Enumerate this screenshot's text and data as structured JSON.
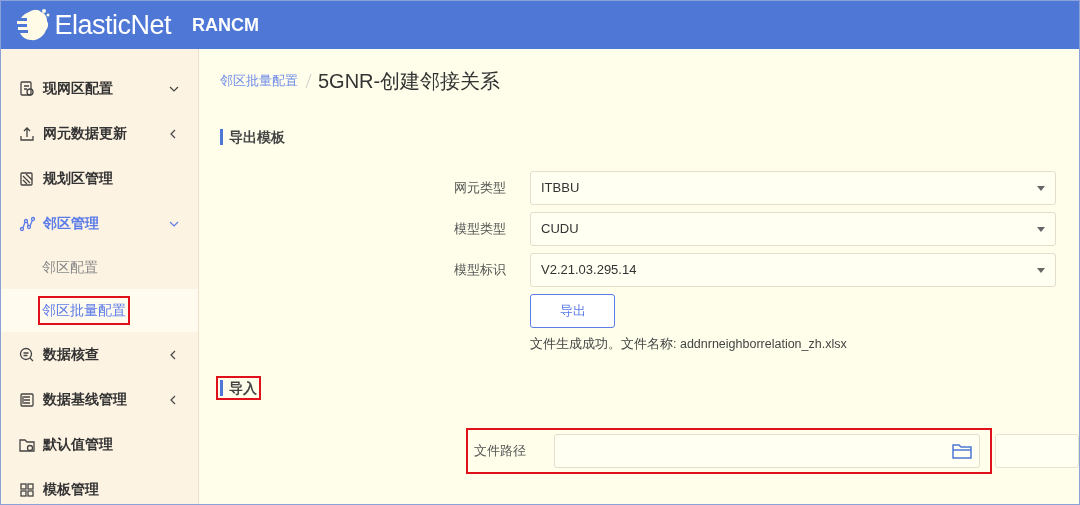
{
  "header": {
    "logo": "ElasticNet",
    "product": "RANCM"
  },
  "sidebar": {
    "items": [
      {
        "label": "现网区配置",
        "expanded": true,
        "selected": false
      },
      {
        "label": "网元数据更新",
        "expanded": false,
        "selected": false
      },
      {
        "label": "规划区管理",
        "selected": false
      },
      {
        "label": "邻区管理",
        "expanded": true,
        "selected": true,
        "children": [
          {
            "label": "邻区配置",
            "selected": false
          },
          {
            "label": "邻区批量配置",
            "selected": true,
            "highlighted": true
          }
        ]
      },
      {
        "label": "数据核查",
        "expanded": false,
        "selected": false
      },
      {
        "label": "数据基线管理",
        "expanded": false,
        "selected": false
      },
      {
        "label": "默认值管理",
        "selected": false
      },
      {
        "label": "模板管理",
        "selected": false
      }
    ]
  },
  "breadcrumb": {
    "parent": "邻区批量配置",
    "current": "5GNR-创建邻接关系"
  },
  "export_section": {
    "title": "导出模板",
    "fields": [
      {
        "label": "网元类型",
        "value": "ITBBU"
      },
      {
        "label": "模型类型",
        "value": "CUDU"
      },
      {
        "label": "模型标识",
        "value": "V2.21.03.295.14"
      }
    ],
    "button": "导出",
    "message": "文件生成成功。文件名称: addnrneighborrelation_zh.xlsx"
  },
  "import_section": {
    "title": "导入",
    "highlighted": true,
    "file_field": {
      "label": "文件路径",
      "highlighted": true,
      "button_disabled": true
    }
  }
}
